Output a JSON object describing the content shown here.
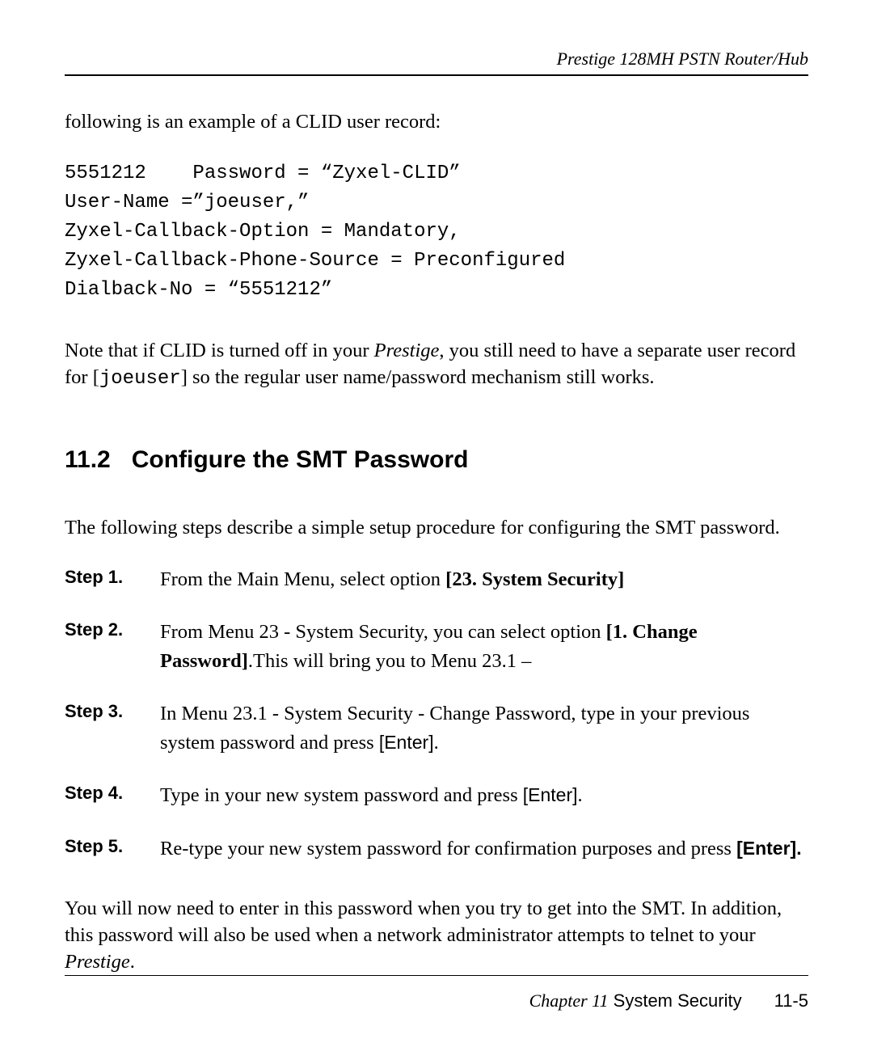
{
  "header": {
    "running_title": "Prestige 128MH    PSTN Router/Hub"
  },
  "intro": {
    "line1": "following is an example of a CLID user record:"
  },
  "code": {
    "l1": "5551212    Password = “Zyxel-CLID”",
    "l2": "User-Name =”joeuser,”",
    "l3": "Zyxel-Callback-Option = Mandatory,",
    "l4": "Zyxel-Callback-Phone-Source = Preconfigured",
    "l5": "Dialback-No = “5551212”"
  },
  "note": {
    "pre": "Note that if CLID is turned off in your ",
    "italic": "Prestige",
    "mid": ", you still need to have a separate user record for [",
    "mono": "joeuser",
    "post": "] so the regular user name/password mechanism still works."
  },
  "section": {
    "number": "11.2",
    "title": "Configure the SMT Password"
  },
  "section_intro": "The following steps describe a simple setup procedure for configuring the SMT password.",
  "steps": {
    "s1": {
      "label": "Step 1.",
      "pre": "From the Main Menu, select option ",
      "bold": "[23. System Security]"
    },
    "s2": {
      "label": "Step 2.",
      "pre": "From Menu 23 - System Security, you can select option ",
      "bold": "[1. Change Password]",
      "post": ".This will bring you to Menu 23.1 –"
    },
    "s3": {
      "label": "Step 3.",
      "pre": "In Menu 23.1 - System Security - Change Password, type in your previous system password and press ",
      "sans": "[Enter]",
      "post": "."
    },
    "s4": {
      "label": "Step 4.",
      "pre": "Type in your new system password and press ",
      "sans": "[Enter]",
      "post": "."
    },
    "s5": {
      "label": "Step 5.",
      "pre": "Re-type your new system password for confirmation purposes and press ",
      "sans": "[Enter].",
      "post": ""
    }
  },
  "closing": {
    "pre": "You will now need to enter in this password when you try to get into the SMT. In addition, this password will also be used when a network administrator attempts to telnet to your ",
    "italic": "Prestige",
    "post": "."
  },
  "footer": {
    "chapter_label": "Chapter 11",
    "chapter_title": " System Security",
    "page_number": "11-5"
  }
}
